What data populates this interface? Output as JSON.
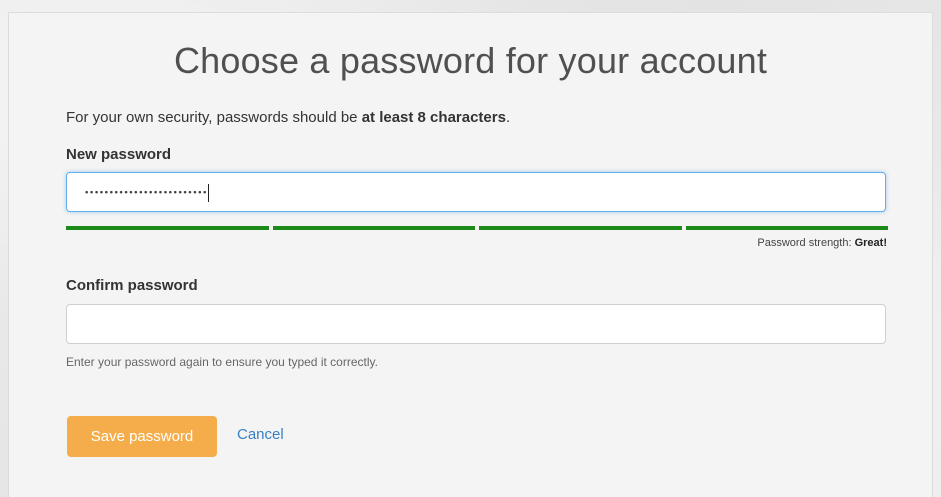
{
  "page": {
    "title": "Choose a password for your account"
  },
  "intro": {
    "prefix": "For your own security, passwords should be ",
    "emphasis": "at least 8 characters",
    "suffix": "."
  },
  "new_password": {
    "label": "New password",
    "masked_value": "•••••••••••••••••••••••••",
    "focused": true
  },
  "strength": {
    "segments_filled": 4,
    "segments_total": 4,
    "label": "Password strength: ",
    "value": "Great!",
    "color": "#1b8a18"
  },
  "confirm_password": {
    "label": "Confirm password",
    "value": "",
    "help": "Enter your password again to ensure you typed it correctly."
  },
  "actions": {
    "save_label": "Save password",
    "cancel_label": "Cancel"
  },
  "colors": {
    "save_button": "#f5ad4b",
    "link": "#3a7fc4",
    "focus_border": "#66afe9"
  }
}
